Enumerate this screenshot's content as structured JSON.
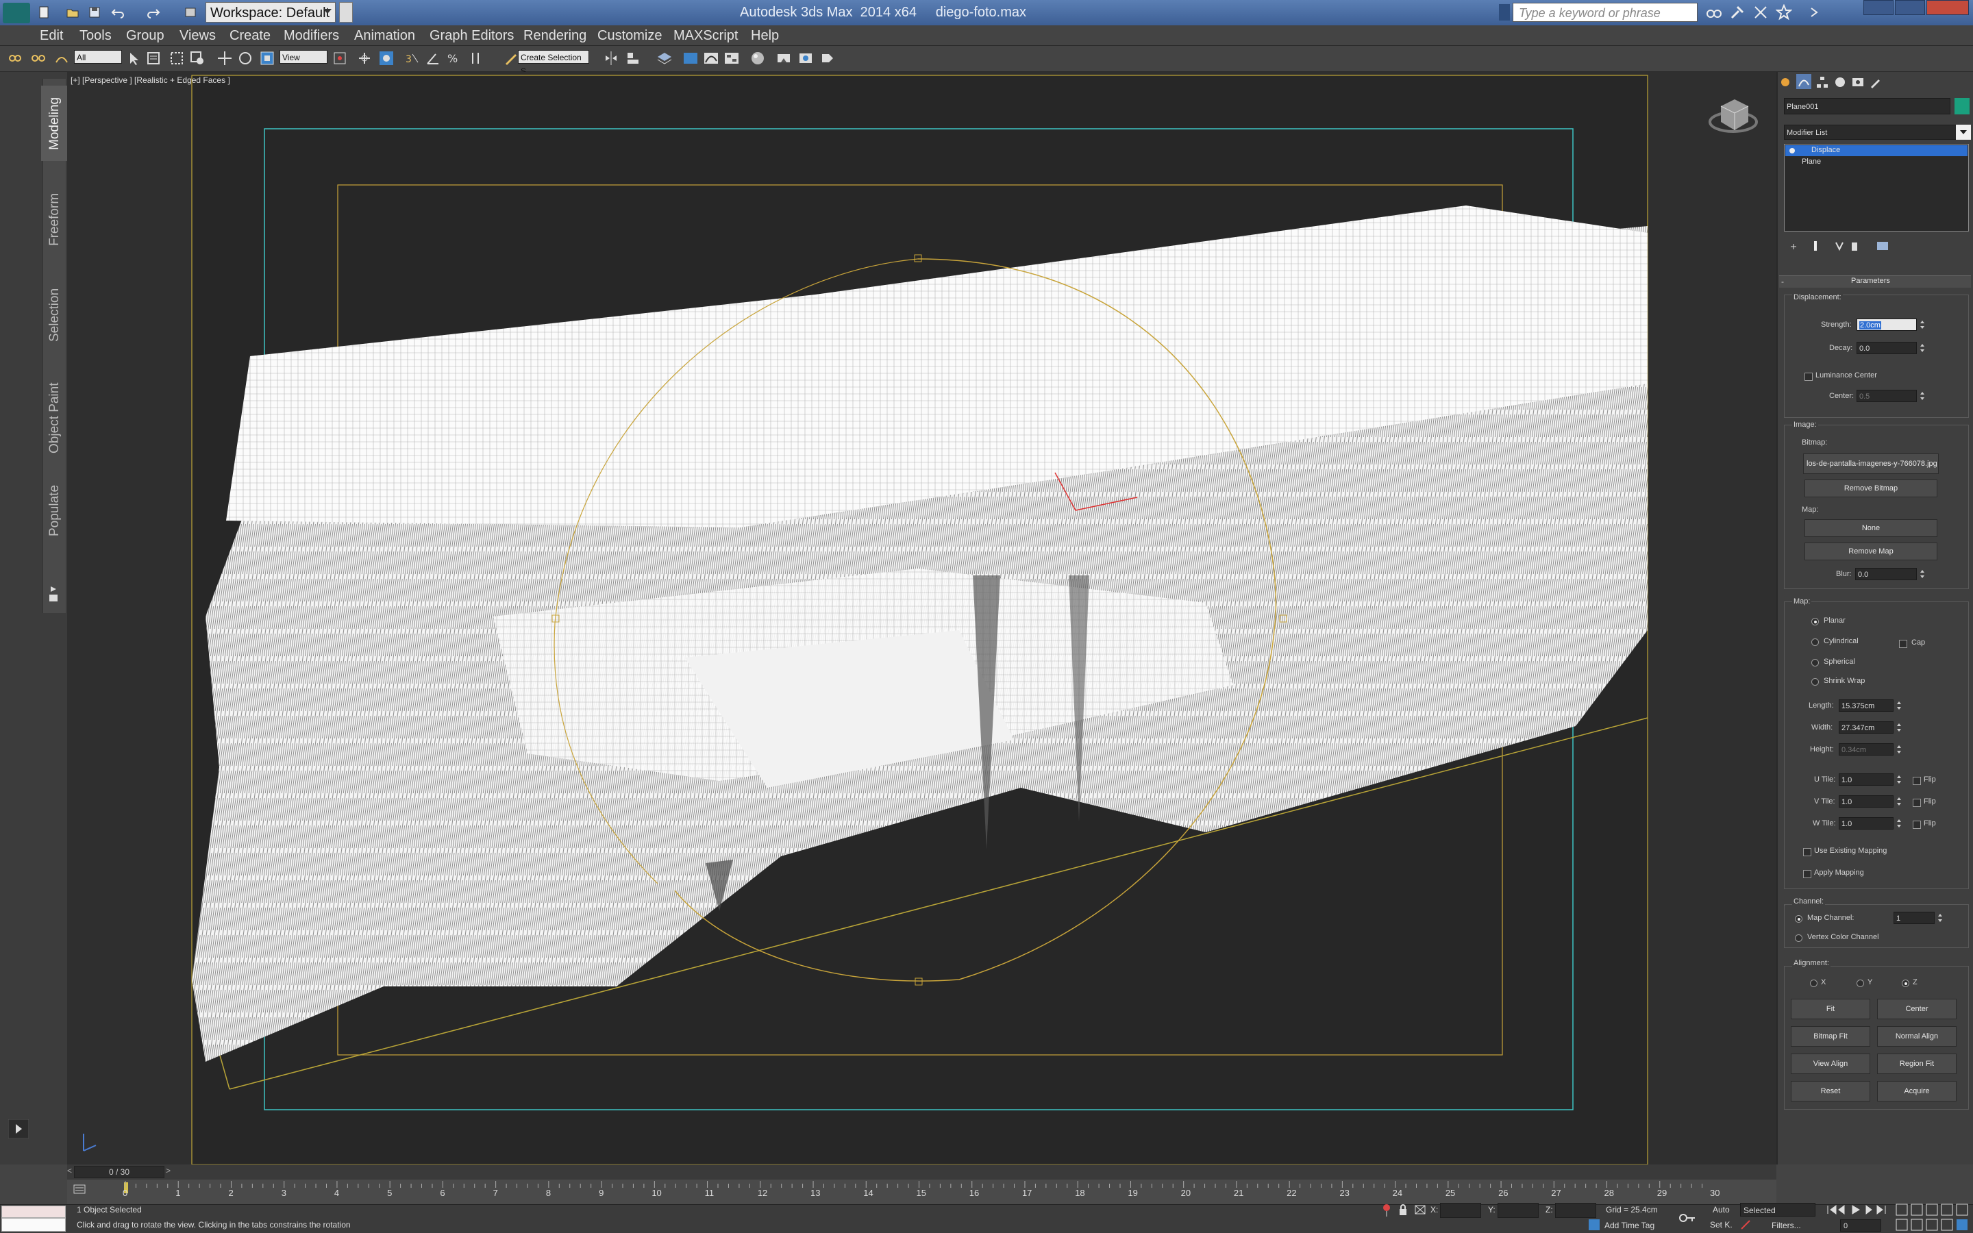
{
  "titlebar": {
    "workspace": "Workspace: Default",
    "title": "Autodesk 3ds Max  2014 x64     diego-foto.max",
    "search_placeholder": "Type a keyword or phrase"
  },
  "menu": [
    "Edit",
    "Tools",
    "Group",
    "Views",
    "Create",
    "Modifiers",
    "Animation",
    "Graph Editors",
    "Rendering",
    "Customize",
    "MAXScript",
    "Help"
  ],
  "toolbar": {
    "selection_filter": "All",
    "ref_coord": "View",
    "named_selection": "Create Selection S"
  },
  "ribbon": {
    "tabs": [
      "Modeling",
      "Freeform",
      "Selection",
      "Object Paint",
      "Populate"
    ]
  },
  "viewport": {
    "label": "[+] [Perspective ] [Realistic + Edged Faces ]"
  },
  "command_panel": {
    "object_name": "Plane001",
    "modifier_list": "Modifier List",
    "stack": [
      "Displace",
      "Plane"
    ],
    "rollout": "Parameters",
    "displacement": {
      "title": "Displacement:",
      "strength_label": "Strength:",
      "strength": "2.0cm",
      "decay_label": "Decay:",
      "decay": "0.0",
      "luminance_center": "Luminance Center",
      "center_label": "Center:",
      "center": "0.5"
    },
    "image": {
      "title": "Image:",
      "bitmap_label": "Bitmap:",
      "bitmap": "los-de-pantalla-imagenes-y-766078.jpg",
      "remove_bitmap": "Remove Bitmap",
      "map_label": "Map:",
      "map_none": "None",
      "remove_map": "Remove Map",
      "blur_label": "Blur:",
      "blur": "0.0"
    },
    "map": {
      "title": "Map:",
      "planar": "Planar",
      "cylindrical": "Cylindrical",
      "cap": "Cap",
      "spherical": "Spherical",
      "shrink_wrap": "Shrink Wrap",
      "length_label": "Length:",
      "length": "15.375cm",
      "width_label": "Width:",
      "width": "27.347cm",
      "height_label": "Height:",
      "height": "0.34cm",
      "utile_label": "U Tile:",
      "utile": "1.0",
      "vtile_label": "V Tile:",
      "vtile": "1.0",
      "wtile_label": "W Tile:",
      "wtile": "1.0",
      "flip": "Flip",
      "use_existing": "Use Existing Mapping",
      "apply_mapping": "Apply Mapping"
    },
    "channel": {
      "title": "Channel:",
      "map_channel": "Map Channel:",
      "map_channel_value": "1",
      "vertex_color": "Vertex Color Channel"
    },
    "alignment": {
      "title": "Alignment:",
      "x": "X",
      "y": "Y",
      "z": "Z",
      "buttons": [
        "Fit",
        "Center",
        "Bitmap Fit",
        "Normal Align",
        "View Align",
        "Region Fit",
        "Reset",
        "Acquire"
      ]
    }
  },
  "timeline": {
    "frame": "0 / 30",
    "ticks": [
      "0",
      "1",
      "2",
      "3",
      "4",
      "5",
      "6",
      "7",
      "8",
      "9",
      "10",
      "11",
      "12",
      "13",
      "14",
      "15",
      "16",
      "17",
      "18",
      "19",
      "20",
      "21",
      "22",
      "23",
      "24",
      "25",
      "26",
      "27",
      "28",
      "29",
      "30"
    ]
  },
  "status": {
    "selected": "1 Object Selected",
    "prompt": "Click and drag to rotate the view.  Clicking in the tabs constrains the rotation",
    "x_label": "X:",
    "y_label": "Y:",
    "z_label": "Z:",
    "grid": "Grid = 25.4cm",
    "add_time_tag": "Add Time Tag",
    "auto": "Auto",
    "set_key": "Set K.",
    "selected_drop": "Selected",
    "filters": "Filters...",
    "frame_value": "0"
  }
}
